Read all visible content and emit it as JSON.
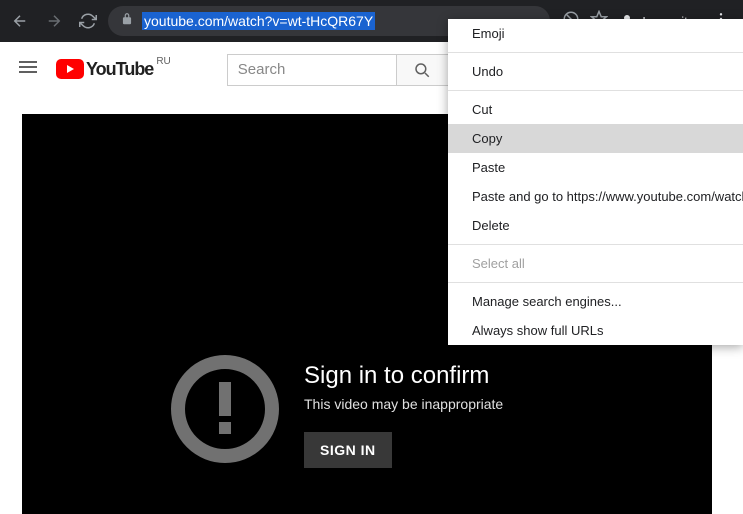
{
  "browser": {
    "url": "youtube.com/watch?v=wt-tHcQR67Y",
    "incognito_label": "Incognito"
  },
  "youtube": {
    "logo_text": "YouTube",
    "region": "RU",
    "search_placeholder": "Search"
  },
  "video": {
    "title": "Sign in to confirm",
    "subtitle": "This video may be inappropriate",
    "signin_label": "SIGN IN"
  },
  "ctx": {
    "emoji": "Emoji",
    "undo": "Undo",
    "cut": "Cut",
    "copy": "Copy",
    "paste": "Paste",
    "pastego": "Paste and go to https://www.youtube.com/watch?v",
    "delete": "Delete",
    "selectall": "Select all",
    "manage": "Manage search engines...",
    "fullurls": "Always show full URLs"
  }
}
